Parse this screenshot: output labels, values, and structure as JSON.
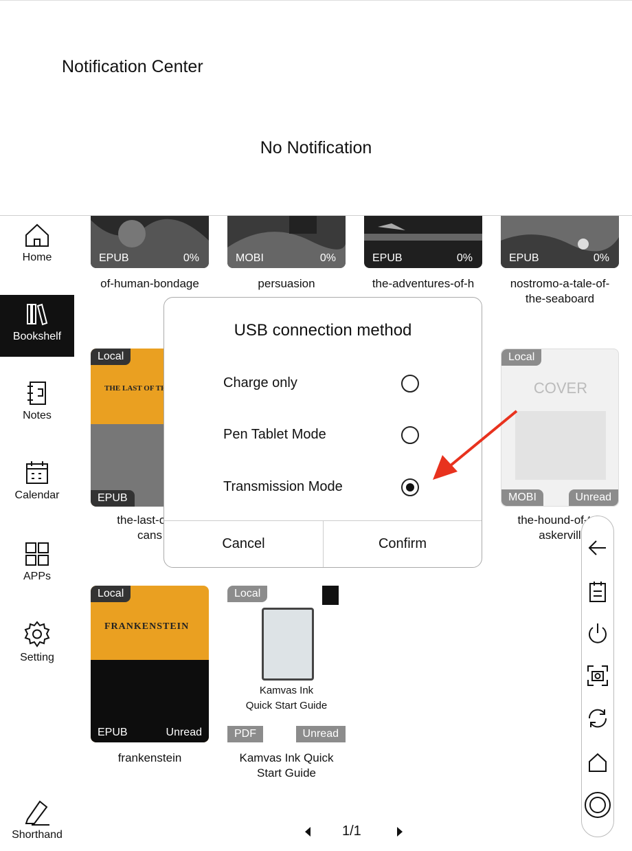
{
  "notification_center": {
    "title": "Notification Center",
    "empty_text": "No Notification"
  },
  "sidebar": {
    "items": [
      {
        "label": "Home",
        "icon": "home-icon"
      },
      {
        "label": "Bookshelf",
        "icon": "bookshelf-icon",
        "active": true
      },
      {
        "label": "Notes",
        "icon": "notes-icon"
      },
      {
        "label": "Calendar",
        "icon": "calendar-icon"
      },
      {
        "label": "APPs",
        "icon": "apps-icon"
      },
      {
        "label": "Setting",
        "icon": "gear-icon"
      },
      {
        "label": "Shorthand",
        "icon": "pen-icon"
      }
    ]
  },
  "books": [
    {
      "title": "of-human-bondage",
      "format": "EPUB",
      "progress": "0%"
    },
    {
      "title": "persuasion",
      "format": "MOBI",
      "progress": "0%"
    },
    {
      "title": "the-adventures-of-h",
      "format": "EPUB",
      "progress": "0%"
    },
    {
      "title": "nostromo-a-tale-of-\nthe-seaboard",
      "format": "EPUB",
      "progress": "0%"
    },
    {
      "title": "the-last-of-th\ncans",
      "format": "EPUB",
      "source": "Local",
      "cover_text": "THE LAST OF THE M"
    },
    {
      "title": "the-hound-of-t  b\naskervill",
      "format": "MOBI",
      "source": "Local",
      "status": "Unread",
      "cover_text": "COVER"
    },
    {
      "title": "frankenstein",
      "format": "EPUB",
      "source": "Local",
      "status": "Unread",
      "cover_text": "FRANKENSTEIN"
    },
    {
      "title": "Kamvas Ink Quick\nStart Guide",
      "format": "PDF",
      "source": "Local",
      "status": "Unread",
      "cover_text": "Kamvas Ink\nQuick Start Guide"
    }
  ],
  "dialog": {
    "title": "USB connection method",
    "options": [
      {
        "label": "Charge only",
        "selected": false
      },
      {
        "label": "Pen Tablet Mode",
        "selected": false
      },
      {
        "label": "Transmission Mode",
        "selected": true
      }
    ],
    "cancel": "Cancel",
    "confirm": "Confirm"
  },
  "pager": {
    "text": "1/1"
  },
  "toolbar": {
    "icons": [
      "back-arrow-icon",
      "notes-icon",
      "power-icon",
      "screenshot-icon",
      "refresh-icon",
      "home-icon",
      "circle-button-icon"
    ]
  },
  "colors": {
    "accent_arrow": "#e8321e",
    "cover_orange": "#eaa021",
    "dark_tag": "#333333",
    "gray_tag": "#8c8c8c"
  }
}
